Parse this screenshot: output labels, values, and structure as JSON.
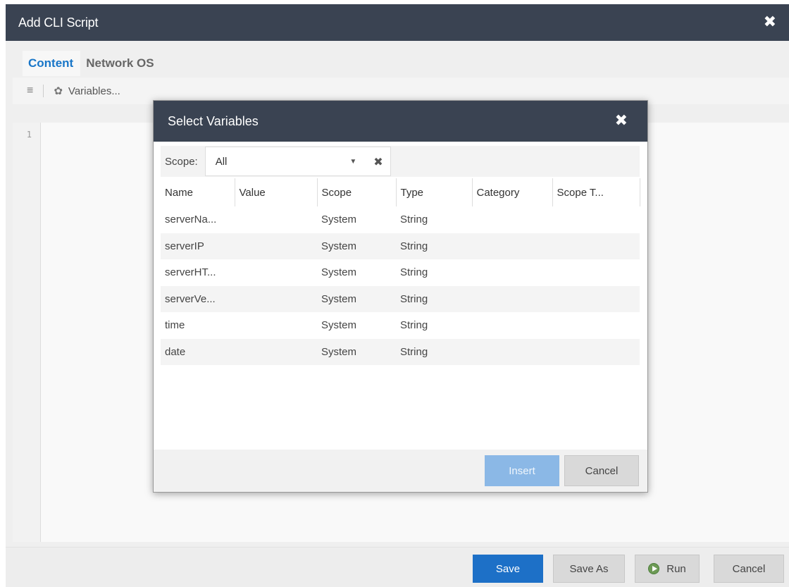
{
  "window": {
    "title": "Add CLI Script",
    "close_label": "✖"
  },
  "tabs": [
    {
      "label": "Content",
      "active": true
    },
    {
      "label": "Network OS",
      "active": false
    }
  ],
  "toolbar": {
    "list_icon": "≡",
    "variables_label": "Variables..."
  },
  "editor": {
    "line_numbers": [
      "1"
    ]
  },
  "dialog": {
    "title": "Select Variables",
    "close_label": "✖",
    "scope": {
      "label": "Scope:",
      "value": "All",
      "caret": "▼",
      "clear": "✖"
    },
    "columns": [
      "Name",
      "Value",
      "Scope",
      "Type",
      "Category",
      "Scope T..."
    ],
    "rows": [
      [
        "serverNa...",
        "",
        "System",
        "String",
        "",
        ""
      ],
      [
        "serverIP",
        "",
        "System",
        "String",
        "",
        ""
      ],
      [
        "serverHT...",
        "",
        "System",
        "String",
        "",
        ""
      ],
      [
        "serverVe...",
        "",
        "System",
        "String",
        "",
        ""
      ],
      [
        "time",
        "",
        "System",
        "String",
        "",
        ""
      ],
      [
        "date",
        "",
        "System",
        "String",
        "",
        ""
      ]
    ],
    "buttons": {
      "insert": "Insert",
      "cancel": "Cancel"
    }
  },
  "footer": {
    "save": "Save",
    "save_as": "Save As",
    "run": "Run",
    "cancel": "Cancel"
  },
  "colors": {
    "titlebar": "#3a4352",
    "primary": "#1d70c7",
    "active_tab": "#1976c8"
  }
}
